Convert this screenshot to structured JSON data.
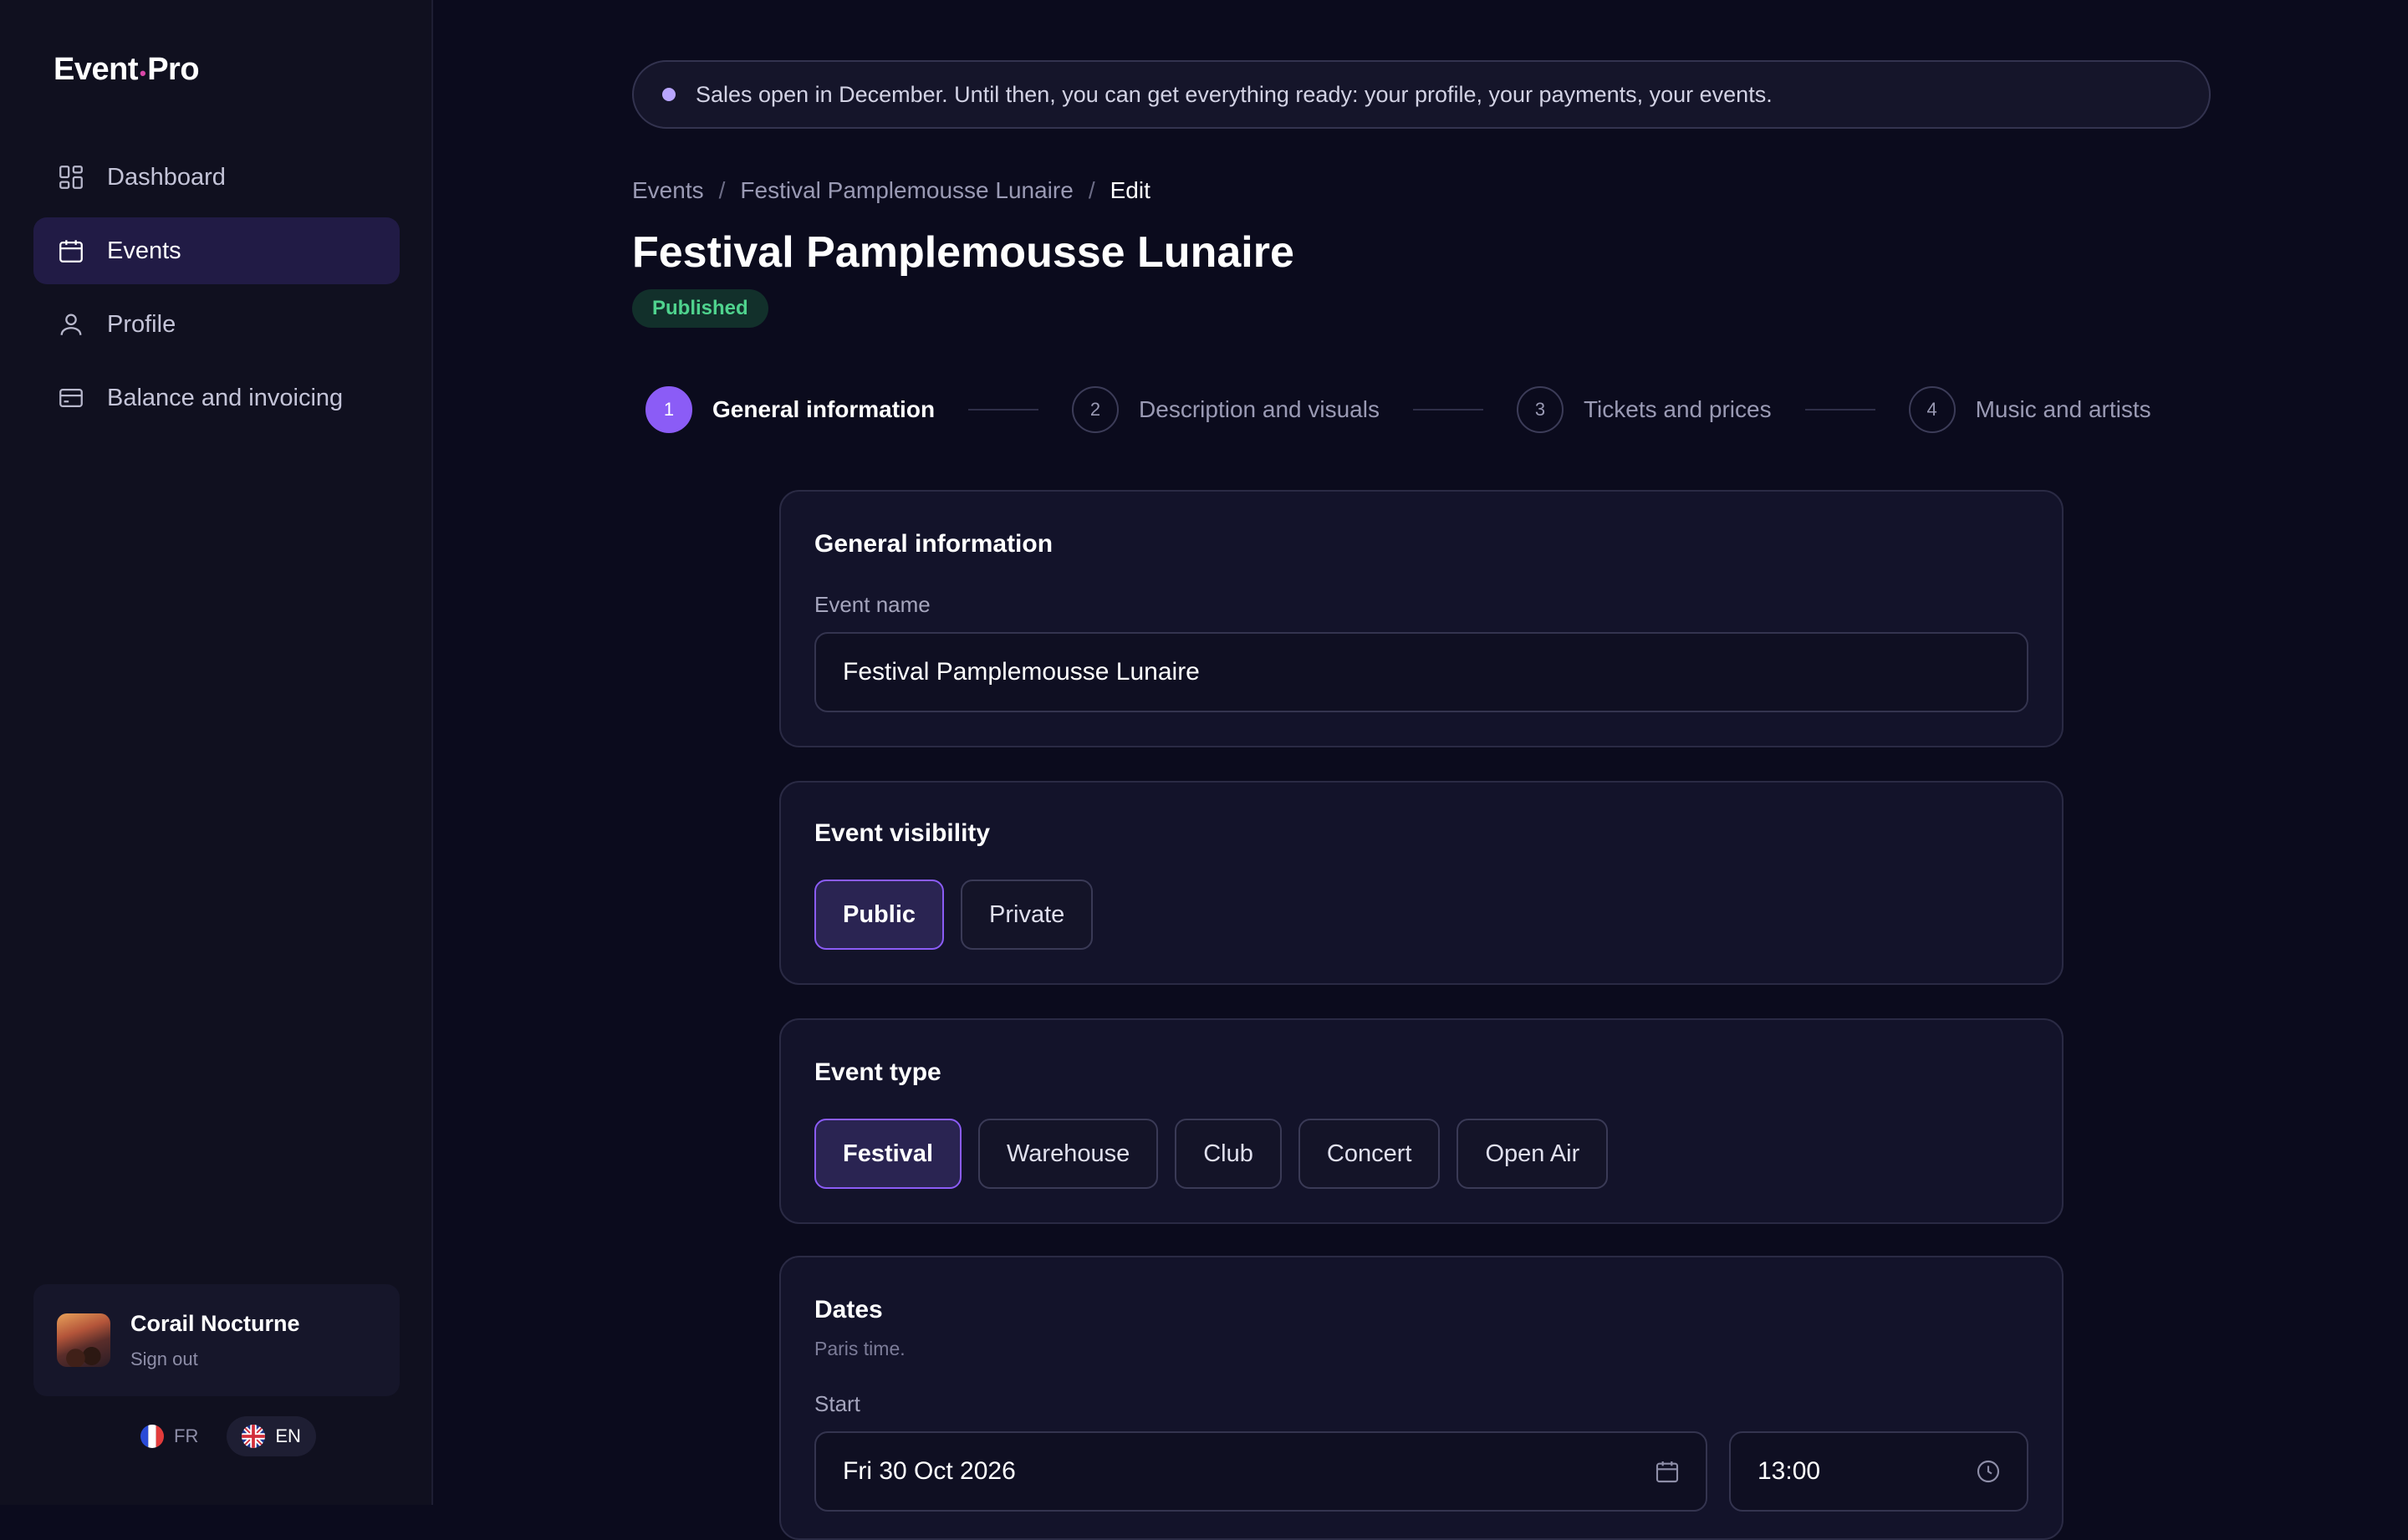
{
  "app": {
    "logo_left": "Event",
    "logo_dot": "•",
    "logo_right": "Pro"
  },
  "sidebar": {
    "items": [
      {
        "label": "Dashboard",
        "icon": "dashboard-icon",
        "active": false
      },
      {
        "label": "Events",
        "icon": "calendar-icon",
        "active": true
      },
      {
        "label": "Profile",
        "icon": "user-icon",
        "active": false
      },
      {
        "label": "Balance and invoicing",
        "icon": "credit-card-icon",
        "active": false
      }
    ],
    "user": {
      "name": "Corail Nocturne",
      "sign_out": "Sign out"
    },
    "languages": [
      {
        "code": "FR",
        "active": false
      },
      {
        "code": "EN",
        "active": true
      }
    ]
  },
  "banner": {
    "text": "Sales open in December. Until then, you can get everything ready: your profile, your payments, your events."
  },
  "breadcrumb": {
    "items": [
      "Events",
      "Festival Pamplemousse Lunaire",
      "Edit"
    ],
    "separator": "/"
  },
  "page": {
    "title": "Festival Pamplemousse Lunaire",
    "status": "Published"
  },
  "stepper": {
    "steps": [
      {
        "num": "1",
        "label": "General information",
        "active": true
      },
      {
        "num": "2",
        "label": "Description and visuals",
        "active": false
      },
      {
        "num": "3",
        "label": "Tickets and prices",
        "active": false
      },
      {
        "num": "4",
        "label": "Music and artists",
        "active": false
      }
    ]
  },
  "general": {
    "title": "General information",
    "name_label": "Event name",
    "name_value": "Festival Pamplemousse Lunaire"
  },
  "visibility": {
    "title": "Event visibility",
    "options": [
      "Public",
      "Private"
    ],
    "selected": "Public"
  },
  "event_type": {
    "title": "Event type",
    "options": [
      "Festival",
      "Warehouse",
      "Club",
      "Concert",
      "Open Air"
    ],
    "selected": "Festival"
  },
  "dates": {
    "title": "Dates",
    "subtitle": "Paris time.",
    "start_label": "Start",
    "start_date": "Fri 30 Oct 2026",
    "start_time": "13:00"
  },
  "colors": {
    "accent": "#8b5cf6",
    "background": "#0b0b1d",
    "sidebar": "#10101f",
    "card": "#13132a",
    "success": "#4fd38e"
  }
}
